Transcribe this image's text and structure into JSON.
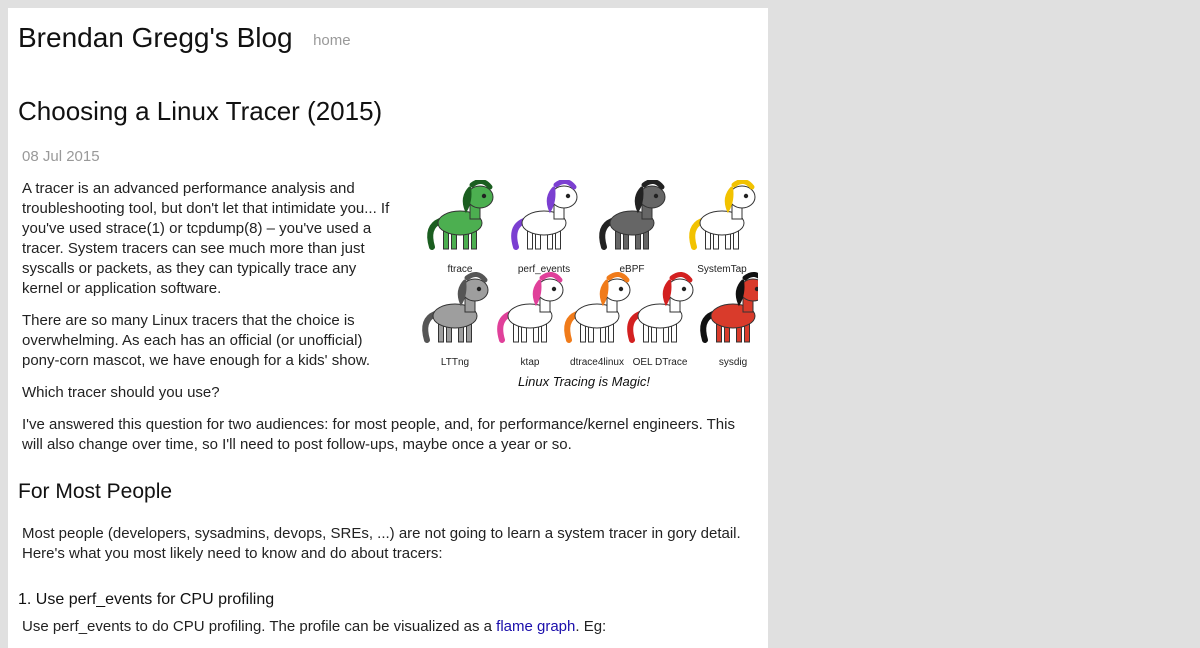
{
  "header": {
    "site_title": "Brendan Gregg's Blog",
    "home_link": "home"
  },
  "post": {
    "title": "Choosing a Linux Tracer (2015)",
    "date": "08 Jul 2015",
    "paragraphs": [
      "A tracer is an advanced performance analysis and troubleshooting tool, but don't let that intimidate you... If you've used strace(1) or tcpdump(8) – you've used a tracer. System tracers can see much more than just syscalls or packets, as they can typically trace any kernel or application software.",
      "There are so many Linux tracers that the choice is overwhelming. As each has an official (or unofficial) pony-corn mascot, we have enough for a kids' show.",
      "Which tracer should you use?",
      "I've answered this question for two audiences: for most people, and, for performance/kernel engineers. This will also change over time, so I'll need to post follow-ups, maybe once a year or so."
    ],
    "figure": {
      "caption": "Linux Tracing is Magic!",
      "mascots": [
        {
          "label": "ftrace",
          "color": "#4caf50",
          "mane": "#1b5e20"
        },
        {
          "label": "perf_events",
          "color": "#ffffff",
          "mane": "#7b3fd1"
        },
        {
          "label": "eBPF",
          "color": "#666666",
          "mane": "#222222"
        },
        {
          "label": "SystemTap",
          "color": "#ffffff",
          "mane": "#f2c200"
        },
        {
          "label": "LTTng",
          "color": "#9e9e9e",
          "mane": "#555555"
        },
        {
          "label": "ktap",
          "color": "#ffffff",
          "mane": "#e0409a"
        },
        {
          "label": "dtrace4linux",
          "color": "#ffffff",
          "mane": "#f07b1a"
        },
        {
          "label": "OEL DTrace",
          "color": "#ffffff",
          "mane": "#d32020"
        },
        {
          "label": "sysdig",
          "color": "#d93b2b",
          "mane": "#111111"
        }
      ]
    },
    "section_heading": "For Most People",
    "section_paragraph": "Most people (developers, sysadmins, devops, SREs, ...) are not going to learn a system tracer in gory detail. Here's what you most likely need to know and do about tracers:",
    "subheading": "1. Use perf_events for CPU profiling",
    "last_paragraph": {
      "before": "Use perf_events to do CPU profiling. The profile can be visualized as a ",
      "link": "flame graph",
      "after": ". Eg:"
    }
  }
}
